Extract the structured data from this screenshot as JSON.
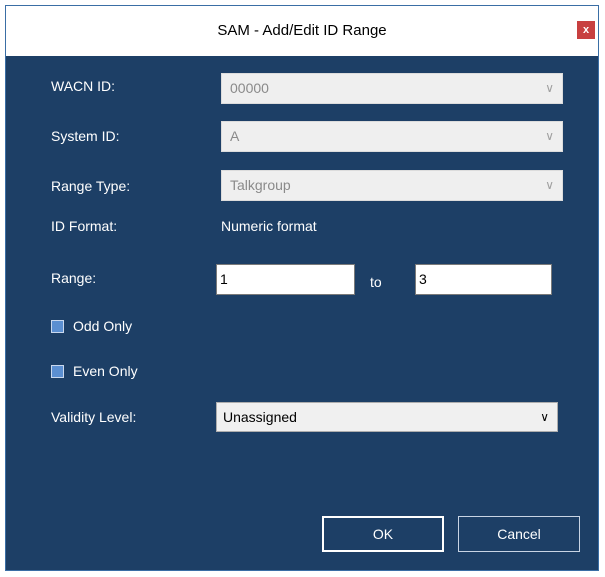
{
  "window": {
    "title": "SAM - Add/Edit ID Range",
    "close_label": "x"
  },
  "fields": {
    "wacn": {
      "label": "WACN ID:",
      "value": "00000"
    },
    "system": {
      "label": "System ID:",
      "value": "A"
    },
    "range_type": {
      "label": "Range Type:",
      "value": "Talkgroup"
    },
    "id_format": {
      "label": "ID Format:",
      "value": "Numeric format"
    },
    "range": {
      "label": "Range:",
      "from": "1",
      "to_label": "to",
      "to": "3"
    },
    "odd_only": {
      "label": "Odd Only",
      "checked": false
    },
    "even_only": {
      "label": "Even Only",
      "checked": false
    },
    "validity": {
      "label": "Validity Level:",
      "value": "Unassigned"
    }
  },
  "buttons": {
    "ok": "OK",
    "cancel": "Cancel"
  },
  "icons": {
    "dropdown": "chevron-down-icon",
    "close": "close-icon"
  },
  "colors": {
    "background": "#1d3f66",
    "close": "#c84040"
  }
}
